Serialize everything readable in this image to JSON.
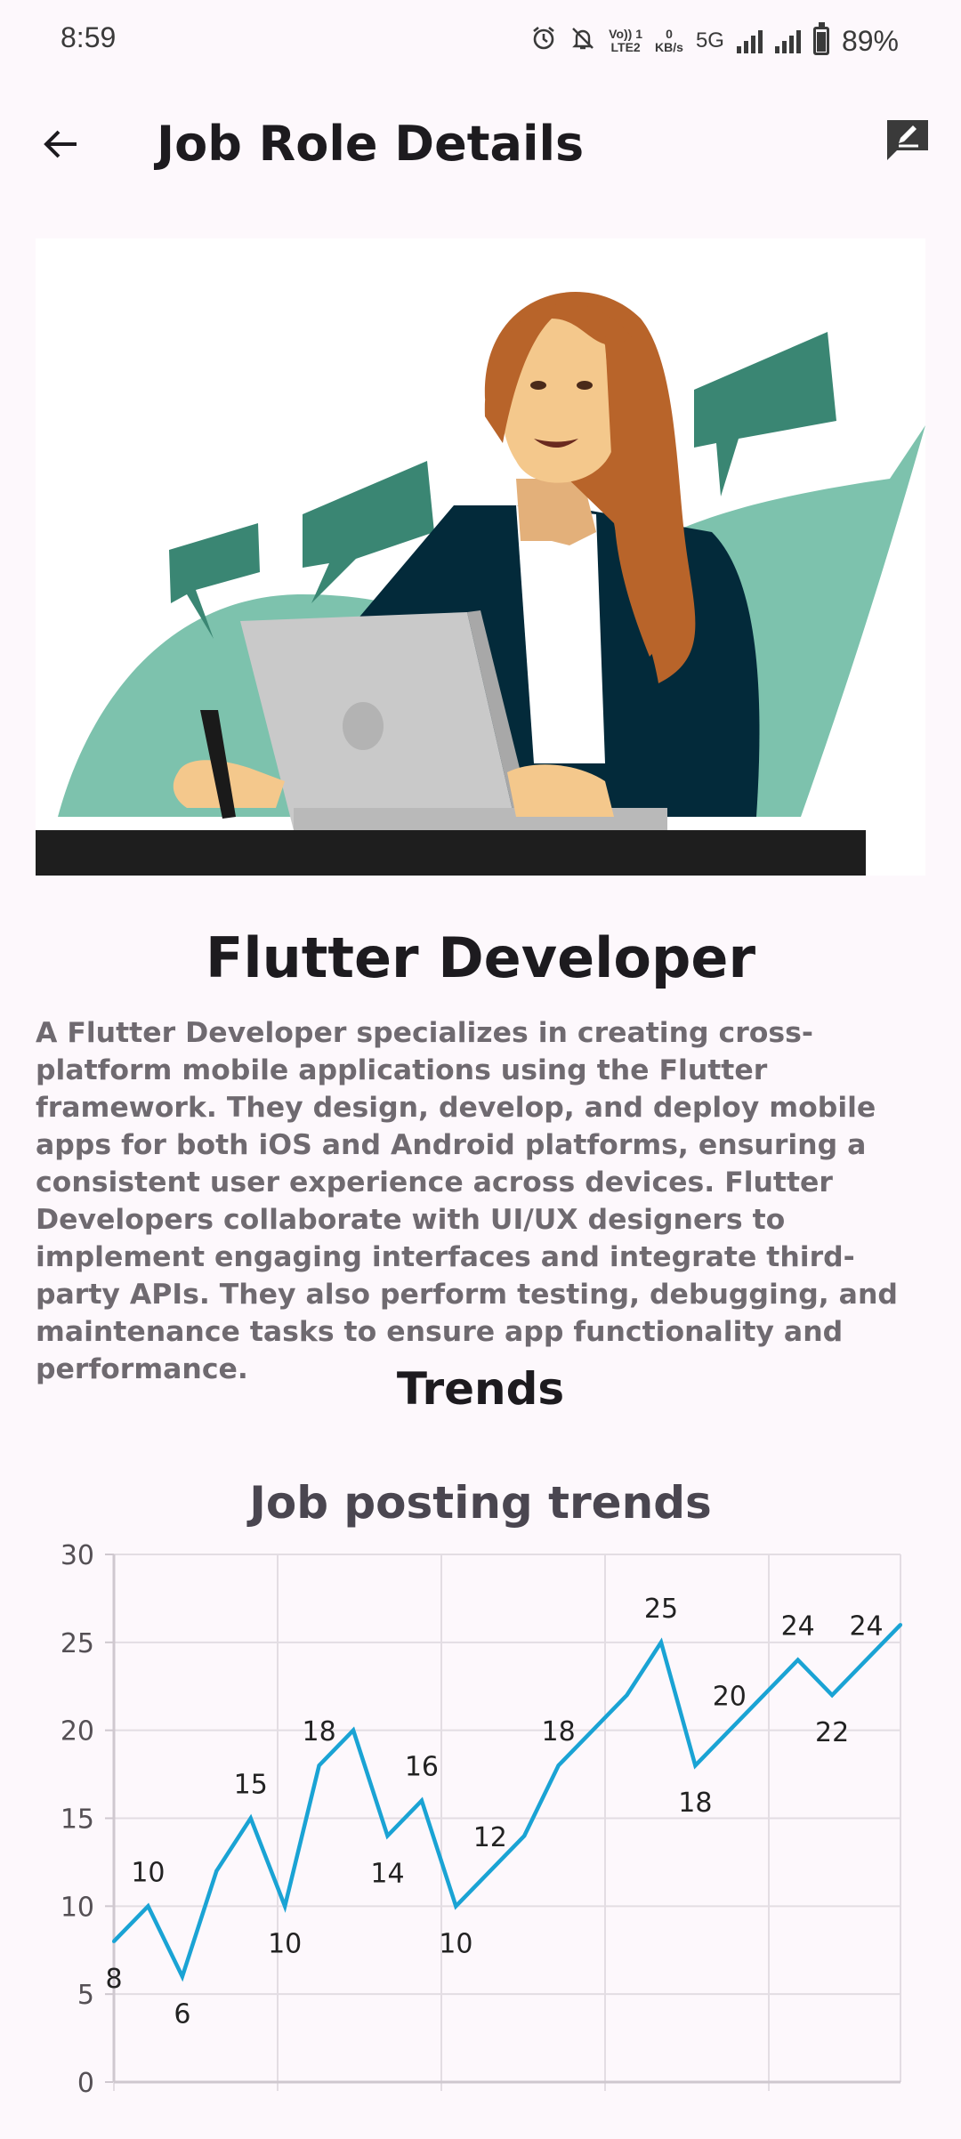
{
  "status_bar": {
    "time": "8:59",
    "volte_top": "Vo)) 1",
    "volte_bottom": "LTE2",
    "speed_top": "0",
    "speed_bottom": "KB/s",
    "network": "5G",
    "battery": "89%"
  },
  "app_bar": {
    "title": "Job Role Details",
    "back_icon": "arrow-left-icon",
    "action_icon": "edit-note-icon"
  },
  "role": {
    "title": "Flutter Developer",
    "description": "A Flutter Developer specializes in creating cross-platform mobile applications using the Flutter framework. They design, develop, and deploy mobile apps for both iOS and Android platforms, ensuring a consistent user experience across devices. Flutter Developers collaborate with UI/UX designers to implement engaging interfaces and integrate third-party APIs. They also perform testing, debugging, and maintenance tasks to ensure app functionality and performance."
  },
  "trends": {
    "heading": "Trends"
  },
  "colors": {
    "line": "#1aa3d4",
    "grid": "#e3dde3",
    "axis": "#cfc8cf"
  },
  "chart_data": {
    "type": "line",
    "title": "Job posting trends",
    "xlabel": "",
    "ylabel": "",
    "ylim": [
      0,
      30
    ],
    "yticks": [
      0,
      5,
      10,
      15,
      20,
      25,
      30
    ],
    "grid": true,
    "series": [
      {
        "values": [
          8,
          10,
          6,
          12,
          15,
          10,
          18,
          20,
          14,
          16,
          10,
          12,
          14,
          18,
          20,
          22,
          25,
          18,
          20,
          22,
          24,
          22,
          24,
          26
        ]
      }
    ],
    "data_labels": [
      {
        "index": 0,
        "text": "8",
        "pos": "below"
      },
      {
        "index": 1,
        "text": "10",
        "pos": "above"
      },
      {
        "index": 2,
        "text": "6",
        "pos": "below"
      },
      {
        "index": 4,
        "text": "15",
        "pos": "above"
      },
      {
        "index": 5,
        "text": "10",
        "pos": "below"
      },
      {
        "index": 6,
        "text": "18",
        "pos": "above"
      },
      {
        "index": 8,
        "text": "14",
        "pos": "below"
      },
      {
        "index": 9,
        "text": "16",
        "pos": "above"
      },
      {
        "index": 10,
        "text": "10",
        "pos": "below"
      },
      {
        "index": 11,
        "text": "12",
        "pos": "above"
      },
      {
        "index": 13,
        "text": "18",
        "pos": "above"
      },
      {
        "index": 16,
        "text": "25",
        "pos": "above"
      },
      {
        "index": 17,
        "text": "18",
        "pos": "below"
      },
      {
        "index": 18,
        "text": "20",
        "pos": "above"
      },
      {
        "index": 20,
        "text": "24",
        "pos": "above"
      },
      {
        "index": 21,
        "text": "22",
        "pos": "below"
      },
      {
        "index": 22,
        "text": "24",
        "pos": "above"
      }
    ]
  }
}
